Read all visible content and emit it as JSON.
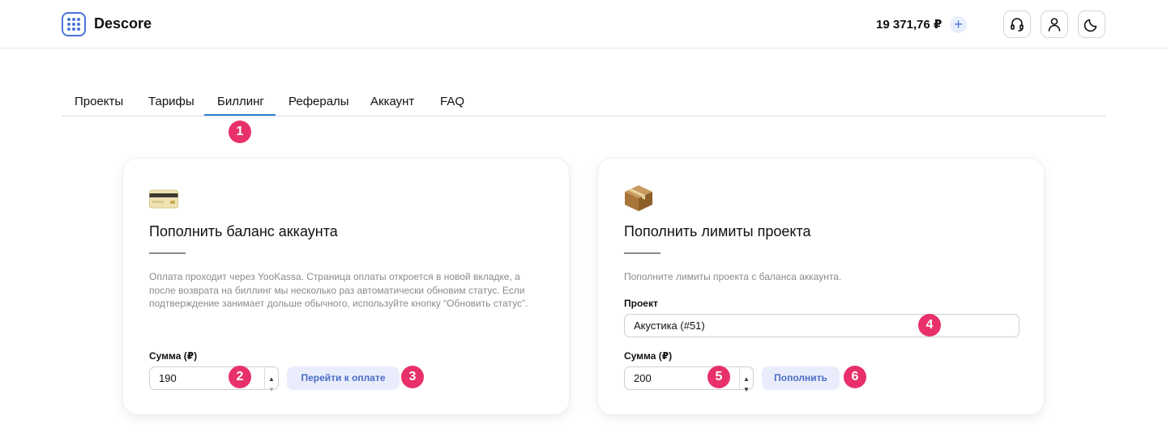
{
  "header": {
    "brand": "Descore",
    "balance": "19 371,76 ₽",
    "add_funds_label": "+",
    "icons": [
      "logo-icon",
      "plus-icon",
      "headset-icon",
      "user-icon",
      "moon-icon"
    ]
  },
  "tabs": [
    {
      "label": "Проекты"
    },
    {
      "label": "Тарифы"
    },
    {
      "label": "Биллинг",
      "active": true
    },
    {
      "label": "Рефералы"
    },
    {
      "label": "Аккаунт"
    },
    {
      "label": "FAQ"
    }
  ],
  "account_card": {
    "icon": "credit-card-emoji",
    "title": "Пополнить баланс аккаунта",
    "description": "Оплата проходит через YooKassa. Страница оплаты откроется в новой вкладке, а после возврата на биллинг мы несколько раз автоматически обновим статус. Если подтверждение занимает дольше обычного, используйте кнопку “Обновить статус”.",
    "amount_label": "Сумма (₽)",
    "amount_value": "190",
    "pay_button": "Перейти к оплате"
  },
  "project_card": {
    "icon": "package-emoji",
    "title": "Пополнить лимиты проекта",
    "description": "Пополните лимиты проекта с баланса аккаунта.",
    "project_label": "Проект",
    "project_value": "Акустика (#51)",
    "amount_label": "Сумма (₽)",
    "amount_value": "200",
    "topup_button": "Пополнить"
  },
  "markers": [
    "1",
    "2",
    "3",
    "4",
    "5",
    "6"
  ],
  "colors": {
    "accent": "#4a74d9",
    "tab_underline": "#2f7ed8",
    "marker": "#e8306b",
    "button_bg": "#e9edfb",
    "button_text": "#4a6bc6"
  }
}
